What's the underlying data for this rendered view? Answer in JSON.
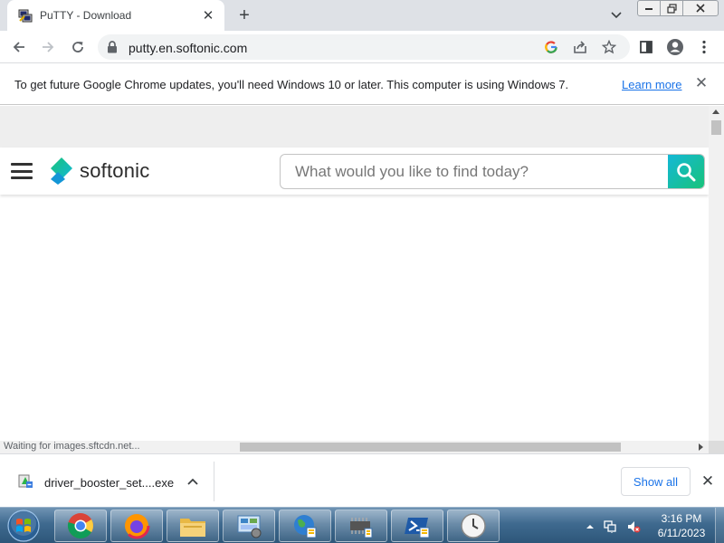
{
  "browser": {
    "tab": {
      "title": "PuTTY - Download",
      "favicon": "putty-icon"
    },
    "address": {
      "url": "putty.en.softonic.com"
    },
    "icons": {
      "back": "back-icon",
      "forward": "forward-icon",
      "reload": "reload-icon",
      "lock": "lock-icon",
      "google": "google-icon",
      "share": "share-icon",
      "bookmark": "star-icon",
      "sidepanel": "side-panel-icon",
      "profile": "profile-icon",
      "menu": "kebab-menu-icon"
    }
  },
  "infobar": {
    "message": "To get future Google Chrome updates, you'll need Windows 10 or later. This computer is using Windows 7.",
    "link": "Learn more"
  },
  "site": {
    "logo": "softonic",
    "search_placeholder": "What would you like to find today?"
  },
  "status": {
    "text": "Waiting for images.sftcdn.net..."
  },
  "download_shelf": {
    "file_name": "driver_booster_set....exe",
    "show_all": "Show all"
  },
  "taskbar": {
    "time": "3:16 PM",
    "date": "6/11/2023",
    "apps": [
      "chrome-icon",
      "firefox-icon",
      "file-explorer-icon",
      "control-panel-icon",
      "network-globe-icon",
      "device-manager-icon",
      "powershell-icon",
      "clock-app-icon"
    ]
  },
  "colors": {
    "chrome_frame": "#dee1e6",
    "link_blue": "#1a73e8",
    "softonic_gradient_start": "#14b8d6",
    "softonic_gradient_end": "#18c37a",
    "taskbar": "#3f6a8f"
  }
}
